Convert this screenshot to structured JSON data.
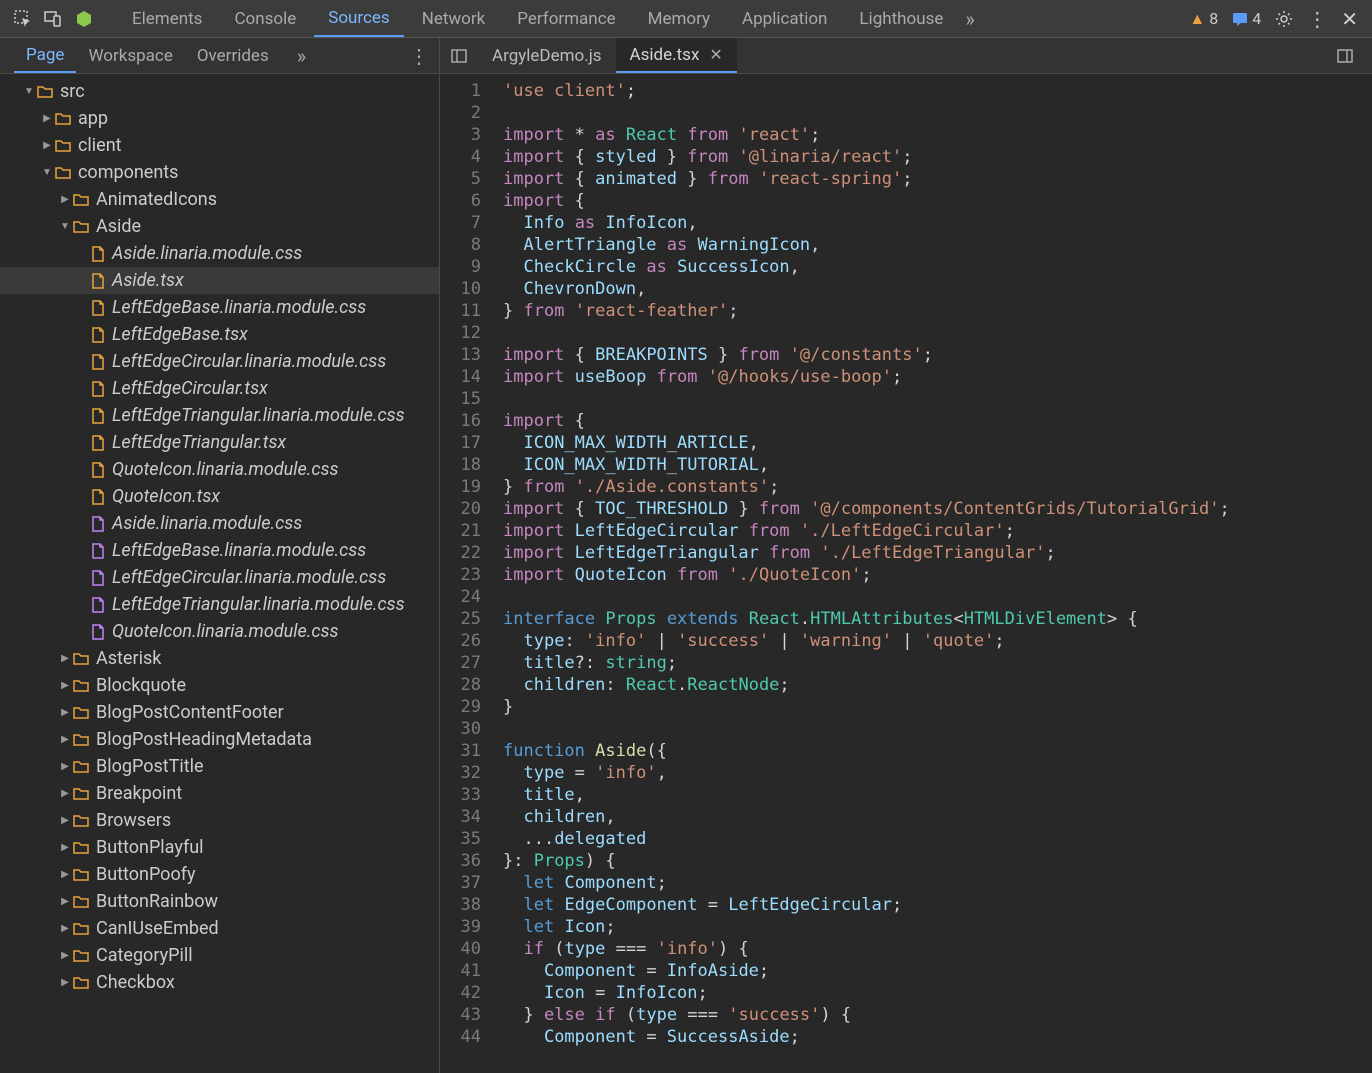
{
  "topTabs": [
    "Elements",
    "Console",
    "Sources",
    "Network",
    "Performance",
    "Memory",
    "Application",
    "Lighthouse"
  ],
  "topActiveIndex": 2,
  "warnings": "8",
  "messages": "4",
  "secondaryTabs": [
    "Page",
    "Workspace",
    "Overrides"
  ],
  "secondaryActiveIndex": 0,
  "editorTabs": [
    {
      "label": "ArgyleDemo.js",
      "active": false,
      "closeable": false
    },
    {
      "label": "Aside.tsx",
      "active": true,
      "closeable": true
    }
  ],
  "tree": [
    {
      "depth": 0,
      "type": "folder",
      "expanded": true,
      "label": "src"
    },
    {
      "depth": 1,
      "type": "folder",
      "expanded": false,
      "label": "app"
    },
    {
      "depth": 1,
      "type": "folder",
      "expanded": false,
      "label": "client"
    },
    {
      "depth": 1,
      "type": "folder",
      "expanded": true,
      "label": "components"
    },
    {
      "depth": 2,
      "type": "folder",
      "expanded": false,
      "label": "AnimatedIcons"
    },
    {
      "depth": 2,
      "type": "folder",
      "expanded": true,
      "label": "Aside"
    },
    {
      "depth": 3,
      "type": "file",
      "color": "orange",
      "label": "Aside.linaria.module.css",
      "italic": true
    },
    {
      "depth": 3,
      "type": "file",
      "color": "orange",
      "label": "Aside.tsx",
      "italic": true,
      "highlighted": true
    },
    {
      "depth": 3,
      "type": "file",
      "color": "orange",
      "label": "LeftEdgeBase.linaria.module.css",
      "italic": true
    },
    {
      "depth": 3,
      "type": "file",
      "color": "orange",
      "label": "LeftEdgeBase.tsx",
      "italic": true
    },
    {
      "depth": 3,
      "type": "file",
      "color": "orange",
      "label": "LeftEdgeCircular.linaria.module.css",
      "italic": true
    },
    {
      "depth": 3,
      "type": "file",
      "color": "orange",
      "label": "LeftEdgeCircular.tsx",
      "italic": true
    },
    {
      "depth": 3,
      "type": "file",
      "color": "orange",
      "label": "LeftEdgeTriangular.linaria.module.css",
      "italic": true
    },
    {
      "depth": 3,
      "type": "file",
      "color": "orange",
      "label": "LeftEdgeTriangular.tsx",
      "italic": true
    },
    {
      "depth": 3,
      "type": "file",
      "color": "orange",
      "label": "QuoteIcon.linaria.module.css",
      "italic": true
    },
    {
      "depth": 3,
      "type": "file",
      "color": "orange",
      "label": "QuoteIcon.tsx",
      "italic": true
    },
    {
      "depth": 3,
      "type": "file",
      "color": "purple",
      "label": "Aside.linaria.module.css",
      "italic": true
    },
    {
      "depth": 3,
      "type": "file",
      "color": "purple",
      "label": "LeftEdgeBase.linaria.module.css",
      "italic": true
    },
    {
      "depth": 3,
      "type": "file",
      "color": "purple",
      "label": "LeftEdgeCircular.linaria.module.css",
      "italic": true
    },
    {
      "depth": 3,
      "type": "file",
      "color": "purple",
      "label": "LeftEdgeTriangular.linaria.module.css",
      "italic": true
    },
    {
      "depth": 3,
      "type": "file",
      "color": "purple",
      "label": "QuoteIcon.linaria.module.css",
      "italic": true
    },
    {
      "depth": 2,
      "type": "folder",
      "expanded": false,
      "label": "Asterisk"
    },
    {
      "depth": 2,
      "type": "folder",
      "expanded": false,
      "label": "Blockquote"
    },
    {
      "depth": 2,
      "type": "folder",
      "expanded": false,
      "label": "BlogPostContentFooter"
    },
    {
      "depth": 2,
      "type": "folder",
      "expanded": false,
      "label": "BlogPostHeadingMetadata"
    },
    {
      "depth": 2,
      "type": "folder",
      "expanded": false,
      "label": "BlogPostTitle"
    },
    {
      "depth": 2,
      "type": "folder",
      "expanded": false,
      "label": "Breakpoint"
    },
    {
      "depth": 2,
      "type": "folder",
      "expanded": false,
      "label": "Browsers"
    },
    {
      "depth": 2,
      "type": "folder",
      "expanded": false,
      "label": "ButtonPlayful"
    },
    {
      "depth": 2,
      "type": "folder",
      "expanded": false,
      "label": "ButtonPoofy"
    },
    {
      "depth": 2,
      "type": "folder",
      "expanded": false,
      "label": "ButtonRainbow"
    },
    {
      "depth": 2,
      "type": "folder",
      "expanded": false,
      "label": "CanIUseEmbed"
    },
    {
      "depth": 2,
      "type": "folder",
      "expanded": false,
      "label": "CategoryPill"
    },
    {
      "depth": 2,
      "type": "folder",
      "expanded": false,
      "label": "Checkbox"
    }
  ],
  "code": [
    [
      {
        "t": "'use client'",
        "c": "tk-str"
      },
      {
        "t": ";",
        "c": "pun"
      }
    ],
    [],
    [
      {
        "t": "import",
        "c": "tk-kw"
      },
      {
        "t": " * ",
        "c": "pun"
      },
      {
        "t": "as",
        "c": "tk-kw"
      },
      {
        "t": " ",
        "c": "pun"
      },
      {
        "t": "React",
        "c": "tk-cls"
      },
      {
        "t": " ",
        "c": "pun"
      },
      {
        "t": "from",
        "c": "tk-kw"
      },
      {
        "t": " ",
        "c": "pun"
      },
      {
        "t": "'react'",
        "c": "tk-str"
      },
      {
        "t": ";",
        "c": "pun"
      }
    ],
    [
      {
        "t": "import",
        "c": "tk-kw"
      },
      {
        "t": " { ",
        "c": "pun"
      },
      {
        "t": "styled",
        "c": "tk-var"
      },
      {
        "t": " } ",
        "c": "pun"
      },
      {
        "t": "from",
        "c": "tk-kw"
      },
      {
        "t": " ",
        "c": "pun"
      },
      {
        "t": "'@linaria/react'",
        "c": "tk-str"
      },
      {
        "t": ";",
        "c": "pun"
      }
    ],
    [
      {
        "t": "import",
        "c": "tk-kw"
      },
      {
        "t": " { ",
        "c": "pun"
      },
      {
        "t": "animated",
        "c": "tk-var"
      },
      {
        "t": " } ",
        "c": "pun"
      },
      {
        "t": "from",
        "c": "tk-kw"
      },
      {
        "t": " ",
        "c": "pun"
      },
      {
        "t": "'react-spring'",
        "c": "tk-str"
      },
      {
        "t": ";",
        "c": "pun"
      }
    ],
    [
      {
        "t": "import",
        "c": "tk-kw"
      },
      {
        "t": " {",
        "c": "pun"
      }
    ],
    [
      {
        "t": "  ",
        "c": "pun"
      },
      {
        "t": "Info",
        "c": "tk-var"
      },
      {
        "t": " ",
        "c": "pun"
      },
      {
        "t": "as",
        "c": "tk-kw"
      },
      {
        "t": " ",
        "c": "pun"
      },
      {
        "t": "InfoIcon",
        "c": "tk-var"
      },
      {
        "t": ",",
        "c": "pun"
      }
    ],
    [
      {
        "t": "  ",
        "c": "pun"
      },
      {
        "t": "AlertTriangle",
        "c": "tk-var"
      },
      {
        "t": " ",
        "c": "pun"
      },
      {
        "t": "as",
        "c": "tk-kw"
      },
      {
        "t": " ",
        "c": "pun"
      },
      {
        "t": "WarningIcon",
        "c": "tk-var"
      },
      {
        "t": ",",
        "c": "pun"
      }
    ],
    [
      {
        "t": "  ",
        "c": "pun"
      },
      {
        "t": "CheckCircle",
        "c": "tk-var"
      },
      {
        "t": " ",
        "c": "pun"
      },
      {
        "t": "as",
        "c": "tk-kw"
      },
      {
        "t": " ",
        "c": "pun"
      },
      {
        "t": "SuccessIcon",
        "c": "tk-var"
      },
      {
        "t": ",",
        "c": "pun"
      }
    ],
    [
      {
        "t": "  ",
        "c": "pun"
      },
      {
        "t": "ChevronDown",
        "c": "tk-var"
      },
      {
        "t": ",",
        "c": "pun"
      }
    ],
    [
      {
        "t": "} ",
        "c": "pun"
      },
      {
        "t": "from",
        "c": "tk-kw"
      },
      {
        "t": " ",
        "c": "pun"
      },
      {
        "t": "'react-feather'",
        "c": "tk-str"
      },
      {
        "t": ";",
        "c": "pun"
      }
    ],
    [],
    [
      {
        "t": "import",
        "c": "tk-kw"
      },
      {
        "t": " { ",
        "c": "pun"
      },
      {
        "t": "BREAKPOINTS",
        "c": "tk-var"
      },
      {
        "t": " } ",
        "c": "pun"
      },
      {
        "t": "from",
        "c": "tk-kw"
      },
      {
        "t": " ",
        "c": "pun"
      },
      {
        "t": "'@/constants'",
        "c": "tk-str"
      },
      {
        "t": ";",
        "c": "pun"
      }
    ],
    [
      {
        "t": "import",
        "c": "tk-kw"
      },
      {
        "t": " ",
        "c": "pun"
      },
      {
        "t": "useBoop",
        "c": "tk-var"
      },
      {
        "t": " ",
        "c": "pun"
      },
      {
        "t": "from",
        "c": "tk-kw"
      },
      {
        "t": " ",
        "c": "pun"
      },
      {
        "t": "'@/hooks/use-boop'",
        "c": "tk-str"
      },
      {
        "t": ";",
        "c": "pun"
      }
    ],
    [],
    [
      {
        "t": "import",
        "c": "tk-kw"
      },
      {
        "t": " {",
        "c": "pun"
      }
    ],
    [
      {
        "t": "  ",
        "c": "pun"
      },
      {
        "t": "ICON_MAX_WIDTH_ARTICLE",
        "c": "tk-var"
      },
      {
        "t": ",",
        "c": "pun"
      }
    ],
    [
      {
        "t": "  ",
        "c": "pun"
      },
      {
        "t": "ICON_MAX_WIDTH_TUTORIAL",
        "c": "tk-var"
      },
      {
        "t": ",",
        "c": "pun"
      }
    ],
    [
      {
        "t": "} ",
        "c": "pun"
      },
      {
        "t": "from",
        "c": "tk-kw"
      },
      {
        "t": " ",
        "c": "pun"
      },
      {
        "t": "'./Aside.constants'",
        "c": "tk-str"
      },
      {
        "t": ";",
        "c": "pun"
      }
    ],
    [
      {
        "t": "import",
        "c": "tk-kw"
      },
      {
        "t": " { ",
        "c": "pun"
      },
      {
        "t": "TOC_THRESHOLD",
        "c": "tk-var"
      },
      {
        "t": " } ",
        "c": "pun"
      },
      {
        "t": "from",
        "c": "tk-kw"
      },
      {
        "t": " ",
        "c": "pun"
      },
      {
        "t": "'@/components/ContentGrids/TutorialGrid'",
        "c": "tk-str"
      },
      {
        "t": ";",
        "c": "pun"
      }
    ],
    [
      {
        "t": "import",
        "c": "tk-kw"
      },
      {
        "t": " ",
        "c": "pun"
      },
      {
        "t": "LeftEdgeCircular",
        "c": "tk-var"
      },
      {
        "t": " ",
        "c": "pun"
      },
      {
        "t": "from",
        "c": "tk-kw"
      },
      {
        "t": " ",
        "c": "pun"
      },
      {
        "t": "'./LeftEdgeCircular'",
        "c": "tk-str"
      },
      {
        "t": ";",
        "c": "pun"
      }
    ],
    [
      {
        "t": "import",
        "c": "tk-kw"
      },
      {
        "t": " ",
        "c": "pun"
      },
      {
        "t": "LeftEdgeTriangular",
        "c": "tk-var"
      },
      {
        "t": " ",
        "c": "pun"
      },
      {
        "t": "from",
        "c": "tk-kw"
      },
      {
        "t": " ",
        "c": "pun"
      },
      {
        "t": "'./LeftEdgeTriangular'",
        "c": "tk-str"
      },
      {
        "t": ";",
        "c": "pun"
      }
    ],
    [
      {
        "t": "import",
        "c": "tk-kw"
      },
      {
        "t": " ",
        "c": "pun"
      },
      {
        "t": "QuoteIcon",
        "c": "tk-var"
      },
      {
        "t": " ",
        "c": "pun"
      },
      {
        "t": "from",
        "c": "tk-kw"
      },
      {
        "t": " ",
        "c": "pun"
      },
      {
        "t": "'./QuoteIcon'",
        "c": "tk-str"
      },
      {
        "t": ";",
        "c": "pun"
      }
    ],
    [],
    [
      {
        "t": "interface",
        "c": "tk-sp"
      },
      {
        "t": " ",
        "c": "pun"
      },
      {
        "t": "Props",
        "c": "tk-cls"
      },
      {
        "t": " ",
        "c": "pun"
      },
      {
        "t": "extends",
        "c": "tk-sp"
      },
      {
        "t": " ",
        "c": "pun"
      },
      {
        "t": "React",
        "c": "tk-cls"
      },
      {
        "t": ".",
        "c": "pun"
      },
      {
        "t": "HTMLAttributes",
        "c": "tk-cls"
      },
      {
        "t": "<",
        "c": "pun"
      },
      {
        "t": "HTMLDivElement",
        "c": "tk-cls"
      },
      {
        "t": "> {",
        "c": "pun"
      }
    ],
    [
      {
        "t": "  ",
        "c": "pun"
      },
      {
        "t": "type",
        "c": "tk-var"
      },
      {
        "t": ": ",
        "c": "pun"
      },
      {
        "t": "'info'",
        "c": "tk-str"
      },
      {
        "t": " | ",
        "c": "pun"
      },
      {
        "t": "'success'",
        "c": "tk-str"
      },
      {
        "t": " | ",
        "c": "pun"
      },
      {
        "t": "'warning'",
        "c": "tk-str"
      },
      {
        "t": " | ",
        "c": "pun"
      },
      {
        "t": "'quote'",
        "c": "tk-str"
      },
      {
        "t": ";",
        "c": "pun"
      }
    ],
    [
      {
        "t": "  ",
        "c": "pun"
      },
      {
        "t": "title",
        "c": "tk-var"
      },
      {
        "t": "?: ",
        "c": "pun"
      },
      {
        "t": "string",
        "c": "tk-cls"
      },
      {
        "t": ";",
        "c": "pun"
      }
    ],
    [
      {
        "t": "  ",
        "c": "pun"
      },
      {
        "t": "children",
        "c": "tk-var"
      },
      {
        "t": ": ",
        "c": "pun"
      },
      {
        "t": "React",
        "c": "tk-cls"
      },
      {
        "t": ".",
        "c": "pun"
      },
      {
        "t": "ReactNode",
        "c": "tk-cls"
      },
      {
        "t": ";",
        "c": "pun"
      }
    ],
    [
      {
        "t": "}",
        "c": "pun"
      }
    ],
    [],
    [
      {
        "t": "function",
        "c": "tk-sp"
      },
      {
        "t": " ",
        "c": "pun"
      },
      {
        "t": "Aside",
        "c": "tk-fn"
      },
      {
        "t": "({",
        "c": "pun"
      }
    ],
    [
      {
        "t": "  ",
        "c": "pun"
      },
      {
        "t": "type",
        "c": "tk-var"
      },
      {
        "t": " = ",
        "c": "pun"
      },
      {
        "t": "'info'",
        "c": "tk-str"
      },
      {
        "t": ",",
        "c": "pun"
      }
    ],
    [
      {
        "t": "  ",
        "c": "pun"
      },
      {
        "t": "title",
        "c": "tk-var"
      },
      {
        "t": ",",
        "c": "pun"
      }
    ],
    [
      {
        "t": "  ",
        "c": "pun"
      },
      {
        "t": "children",
        "c": "tk-var"
      },
      {
        "t": ",",
        "c": "pun"
      }
    ],
    [
      {
        "t": "  ...",
        "c": "pun"
      },
      {
        "t": "delegated",
        "c": "tk-var"
      }
    ],
    [
      {
        "t": "}: ",
        "c": "pun"
      },
      {
        "t": "Props",
        "c": "tk-cls"
      },
      {
        "t": ") {",
        "c": "pun"
      }
    ],
    [
      {
        "t": "  ",
        "c": "pun"
      },
      {
        "t": "let",
        "c": "tk-sp"
      },
      {
        "t": " ",
        "c": "pun"
      },
      {
        "t": "Component",
        "c": "tk-var"
      },
      {
        "t": ";",
        "c": "pun"
      }
    ],
    [
      {
        "t": "  ",
        "c": "pun"
      },
      {
        "t": "let",
        "c": "tk-sp"
      },
      {
        "t": " ",
        "c": "pun"
      },
      {
        "t": "EdgeComponent",
        "c": "tk-var"
      },
      {
        "t": " = ",
        "c": "pun"
      },
      {
        "t": "LeftEdgeCircular",
        "c": "tk-var"
      },
      {
        "t": ";",
        "c": "pun"
      }
    ],
    [
      {
        "t": "  ",
        "c": "pun"
      },
      {
        "t": "let",
        "c": "tk-sp"
      },
      {
        "t": " ",
        "c": "pun"
      },
      {
        "t": "Icon",
        "c": "tk-var"
      },
      {
        "t": ";",
        "c": "pun"
      }
    ],
    [
      {
        "t": "  ",
        "c": "pun"
      },
      {
        "t": "if",
        "c": "tk-kw"
      },
      {
        "t": " (",
        "c": "pun"
      },
      {
        "t": "type",
        "c": "tk-var"
      },
      {
        "t": " === ",
        "c": "pun"
      },
      {
        "t": "'info'",
        "c": "tk-str"
      },
      {
        "t": ") {",
        "c": "pun"
      }
    ],
    [
      {
        "t": "    ",
        "c": "pun"
      },
      {
        "t": "Component",
        "c": "tk-var"
      },
      {
        "t": " = ",
        "c": "pun"
      },
      {
        "t": "InfoAside",
        "c": "tk-var"
      },
      {
        "t": ";",
        "c": "pun"
      }
    ],
    [
      {
        "t": "    ",
        "c": "pun"
      },
      {
        "t": "Icon",
        "c": "tk-var"
      },
      {
        "t": " = ",
        "c": "pun"
      },
      {
        "t": "InfoIcon",
        "c": "tk-var"
      },
      {
        "t": ";",
        "c": "pun"
      }
    ],
    [
      {
        "t": "  } ",
        "c": "pun"
      },
      {
        "t": "else",
        "c": "tk-kw"
      },
      {
        "t": " ",
        "c": "pun"
      },
      {
        "t": "if",
        "c": "tk-kw"
      },
      {
        "t": " (",
        "c": "pun"
      },
      {
        "t": "type",
        "c": "tk-var"
      },
      {
        "t": " === ",
        "c": "pun"
      },
      {
        "t": "'success'",
        "c": "tk-str"
      },
      {
        "t": ") {",
        "c": "pun"
      }
    ],
    [
      {
        "t": "    ",
        "c": "pun"
      },
      {
        "t": "Component",
        "c": "tk-var"
      },
      {
        "t": " = ",
        "c": "pun"
      },
      {
        "t": "SuccessAside",
        "c": "tk-var"
      },
      {
        "t": ";",
        "c": "pun"
      }
    ]
  ]
}
